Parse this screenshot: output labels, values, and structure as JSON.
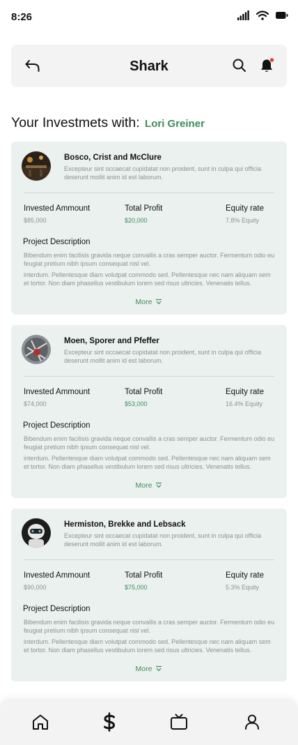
{
  "status_bar": {
    "time": "8:26"
  },
  "header": {
    "title": "Shark"
  },
  "section": {
    "heading": "Your Investmets with:",
    "shark_name": "Lori Greiner"
  },
  "investments": [
    {
      "company": "Bosco, Crist and McClure",
      "description": "Excepteur sint occaecat cupidatat non proident, sunt in culpa qui officia deserunt mollit anim id est laborum.",
      "invested_label": "Invested Ammount",
      "invested_value": "$85,000",
      "profit_label": "Total Profit",
      "profit_value": "$20,000",
      "equity_label": "Equity rate",
      "equity_value": "7.8% Equity",
      "project_title": "Project Description",
      "project_p1": "Bibendum enim facilisis gravida neque convallis a cras semper auctor. Fermentum odio eu feugiat pretium nibh ipsum consequat nisl vel.",
      "project_p2": "interdum. Pellentesque diam volutpat commodo sed. Pellentesque nec nam aliquam sem et tortor. Non diam phasellus vestibulum lorem sed risus ultricies. Venenatis tellus.",
      "more_label": "More"
    },
    {
      "company": "Moen, Sporer and Pfeffer",
      "description": "Excepteur sint occaecat cupidatat non proident, sunt in culpa qui officia deserunt mollit anim id est laborum.",
      "invested_label": "Invested Ammount",
      "invested_value": "$74,000",
      "profit_label": "Total Profit",
      "profit_value": "$53,000",
      "equity_label": "Equity rate",
      "equity_value": "16.4% Equity",
      "project_title": "Project Description",
      "project_p1": "Bibendum enim facilisis gravida neque convallis a cras semper auctor. Fermentum odio eu feugiat pretium nibh ipsum consequat nisl vel.",
      "project_p2": "interdum. Pellentesque diam volutpat commodo sed. Pellentesque nec nam aliquam sem et tortor. Non diam phasellus vestibulum lorem sed risus ultricies. Venenatis tellus.",
      "more_label": "More"
    },
    {
      "company": "Hermiston, Brekke and Lebsack",
      "description": "Excepteur sint occaecat cupidatat non proident, sunt in culpa qui officia deserunt mollit anim id est laborum.",
      "invested_label": "Invested Ammount",
      "invested_value": "$90,000",
      "profit_label": "Total Profit",
      "profit_value": "$75,000",
      "equity_label": "Equity rate",
      "equity_value": "5.3% Equity",
      "project_title": "Project Description",
      "project_p1": "Bibendum enim facilisis gravida neque convallis a cras semper auctor. Fermentum odio eu feugiat pretium nibh ipsum consequat nisl vel.",
      "project_p2": "interdum. Pellentesque diam volutpat commodo sed. Pellentesque nec nam aliquam sem et tortor. Non diam phasellus vestibulum lorem sed risus ultricies. Venenatis tellus.",
      "more_label": "More"
    }
  ],
  "colors": {
    "accent": "#3d8b5c",
    "card_bg": "#ebf1ee",
    "notification_dot": "#e53935"
  },
  "icons": {
    "back": "back-arrow-icon",
    "search": "search-icon",
    "bell": "bell-icon",
    "nav": [
      "home-icon",
      "dollar-icon",
      "tv-icon",
      "profile-icon"
    ]
  }
}
